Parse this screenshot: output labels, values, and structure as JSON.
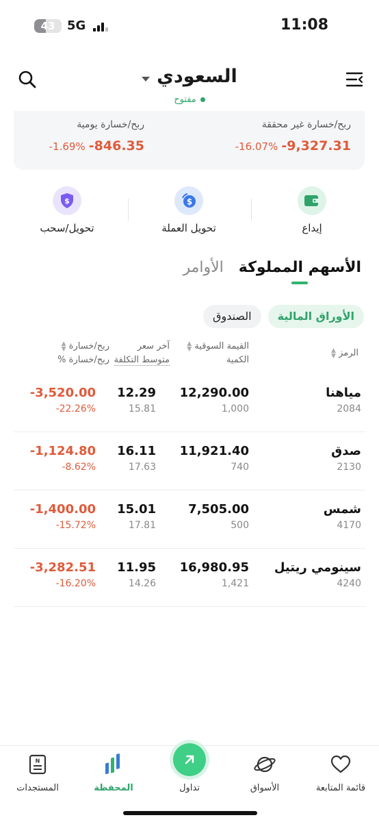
{
  "status_bar": {
    "battery_level": "43",
    "network": "5G",
    "time": "11:08"
  },
  "header": {
    "market_name": "السعودي",
    "market_status": "مفتوح",
    "search_icon": "search-icon",
    "menu_icon": "menu-icon"
  },
  "summary": {
    "unrealized_label": "ربح/خسارة غير محققة",
    "unrealized_amount": "-9,327.31",
    "unrealized_pct": "-16.07%",
    "daily_label": "ربح/خسارة يومية",
    "daily_amount": "-846.35",
    "daily_pct": "-1.69%"
  },
  "actions": {
    "deposit": "إيداع",
    "convert": "تحويل العملة",
    "withdraw": "تحويل/سحب"
  },
  "tabs": {
    "holdings": "الأسهم المملوكة",
    "orders": "الأوامر"
  },
  "subtabs": {
    "securities": "الأوراق المالية",
    "fund": "الصندوق"
  },
  "table": {
    "headers": {
      "symbol": "الرمز",
      "market_value": "القيمة السوقية",
      "quantity": "الكمية",
      "last_price": "آخر سعر",
      "avg_cost": "متوسط التكلفة",
      "pl": "ربح/خسارة",
      "pl_pct": "ربح/خسارة %"
    },
    "rows": [
      {
        "name": "مياهنا",
        "code": "2084",
        "market_value": "12,290.00",
        "quantity": "1,000",
        "last_price": "12.29",
        "avg_cost": "15.81",
        "pl": "-3,520.00",
        "pl_pct": "-22.26%"
      },
      {
        "name": "صدق",
        "code": "2130",
        "market_value": "11,921.40",
        "quantity": "740",
        "last_price": "16.11",
        "avg_cost": "17.63",
        "pl": "-1,124.80",
        "pl_pct": "-8.62%"
      },
      {
        "name": "شمس",
        "code": "4170",
        "market_value": "7,505.00",
        "quantity": "500",
        "last_price": "15.01",
        "avg_cost": "17.81",
        "pl": "-1,400.00",
        "pl_pct": "-15.72%"
      },
      {
        "name": "سينومي ريتيل",
        "code": "4240",
        "market_value": "16,980.95",
        "quantity": "1,421",
        "last_price": "11.95",
        "avg_cost": "14.26",
        "pl": "-3,282.51",
        "pl_pct": "-16.20%"
      }
    ]
  },
  "bottom_nav": {
    "watchlist": "قائمة المتابعة",
    "markets": "الأسواق",
    "trade": "تداول",
    "portfolio": "المحفظة",
    "news": "المستجدات"
  },
  "colors": {
    "accent_green": "#2fa36b",
    "loss_red": "#e05a3a"
  }
}
